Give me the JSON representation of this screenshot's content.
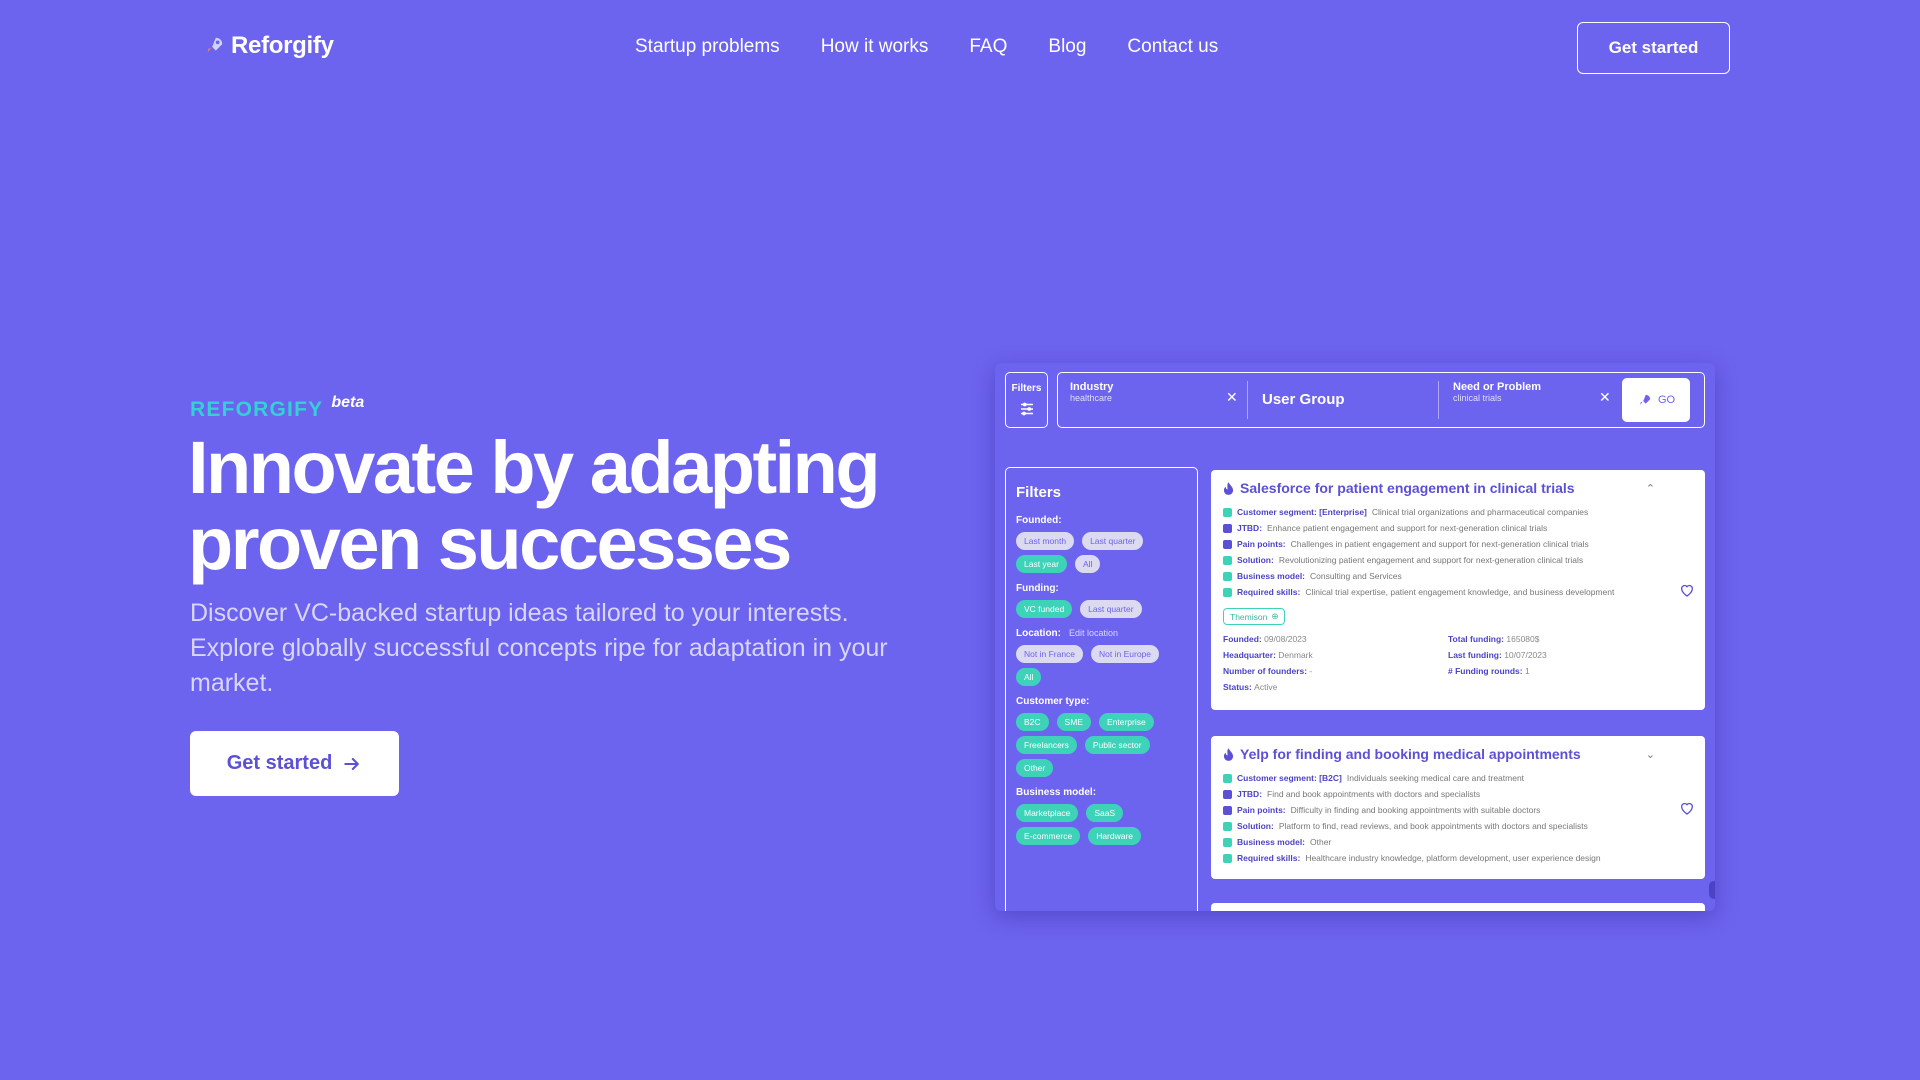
{
  "brand": {
    "name": "Reforgify"
  },
  "nav": {
    "links": [
      "Startup problems",
      "How it works",
      "FAQ",
      "Blog",
      "Contact us"
    ],
    "cta": "Get started"
  },
  "hero": {
    "eyebrow": "REFORGIFY",
    "badge": "beta",
    "headline_line1": "Innovate by adapting",
    "headline_line2": "proven successes",
    "subtext": "Discover VC-backed startup ideas tailored to your interests. Explore globally successful concepts ripe for adaptation in your market.",
    "cta": "Get started"
  },
  "colors": {
    "background": "#6c63ee",
    "accent": "#35d0d6",
    "chip_active": "#3ed3b9"
  },
  "mockup": {
    "filters_button": "Filters",
    "search": {
      "industry_title": "Industry",
      "industry_value": "healthcare",
      "user_group": "User Group",
      "need_title": "Need or Problem",
      "need_value": "clinical trials",
      "go": "GO"
    },
    "sidebar": {
      "title": "Filters",
      "founded": {
        "label": "Founded:",
        "chips": [
          {
            "text": "Last month",
            "on": false
          },
          {
            "text": "Last quarter",
            "on": false
          },
          {
            "text": "Last year",
            "on": true
          },
          {
            "text": "All",
            "on": false
          }
        ]
      },
      "funding": {
        "label": "Funding:",
        "chips": [
          {
            "text": "VC funded",
            "on": true
          },
          {
            "text": "Last quarter",
            "on": false
          }
        ]
      },
      "location": {
        "label": "Location:",
        "edit": "Edit location",
        "chips": [
          {
            "text": "Not in France",
            "on": false
          },
          {
            "text": "Not in Europe",
            "on": false
          },
          {
            "text": "All",
            "on": true
          }
        ]
      },
      "customer": {
        "label": "Customer type:",
        "chips": [
          {
            "text": "B2C",
            "on": true
          },
          {
            "text": "SME",
            "on": true
          },
          {
            "text": "Enterprise",
            "on": true
          },
          {
            "text": "Freelancers",
            "on": true
          },
          {
            "text": "Public sector",
            "on": true
          },
          {
            "text": "Other",
            "on": true
          }
        ]
      },
      "business": {
        "label": "Business model:",
        "chips": [
          {
            "text": "Marketplace",
            "on": true
          },
          {
            "text": "SaaS",
            "on": true
          },
          {
            "text": "E-commerce",
            "on": true
          },
          {
            "text": "Hardware",
            "on": true
          }
        ]
      }
    },
    "cards": [
      {
        "title": "Salesforce for patient engagement in clinical trials",
        "rows": [
          {
            "k": "Customer segment: [Enterprise]",
            "v": "Clinical trial organizations and pharmaceutical companies"
          },
          {
            "k": "JTBD:",
            "v": "Enhance patient engagement and support for next-generation clinical trials"
          },
          {
            "k": "Pain points:",
            "v": "Challenges in patient engagement and support for next-generation clinical trials"
          },
          {
            "k": "Solution:",
            "v": "Revolutionizing patient engagement and support for next-generation clinical trials"
          },
          {
            "k": "Business model:",
            "v": "Consulting and Services"
          },
          {
            "k": "Required skills:",
            "v": "Clinical trial expertise, patient engagement knowledge, and business development"
          }
        ],
        "tag": "Themison",
        "meta": [
          {
            "k": "Founded:",
            "v": "09/08/2023"
          },
          {
            "k": "Total funding:",
            "v": "165080$"
          },
          {
            "k": "Headquarter:",
            "v": "Denmark"
          },
          {
            "k": "Last funding:",
            "v": "10/07/2023"
          },
          {
            "k": "Number of founders:",
            "v": "-"
          },
          {
            "k": "# Funding rounds:",
            "v": "1"
          },
          {
            "k": "Status:",
            "v": "Active"
          }
        ]
      },
      {
        "title": "Yelp for finding and booking medical appointments",
        "rows": [
          {
            "k": "Customer segment: [B2C]",
            "v": "Individuals seeking medical care and treatment"
          },
          {
            "k": "JTBD:",
            "v": "Find and book appointments with doctors and specialists"
          },
          {
            "k": "Pain points:",
            "v": "Difficulty in finding and booking appointments with suitable doctors"
          },
          {
            "k": "Solution:",
            "v": "Platform to find, read reviews, and book appointments with doctors and specialists"
          },
          {
            "k": "Business model:",
            "v": "Other"
          },
          {
            "k": "Required skills:",
            "v": "Healthcare industry knowledge, platform development, user experience design"
          }
        ]
      }
    ]
  }
}
